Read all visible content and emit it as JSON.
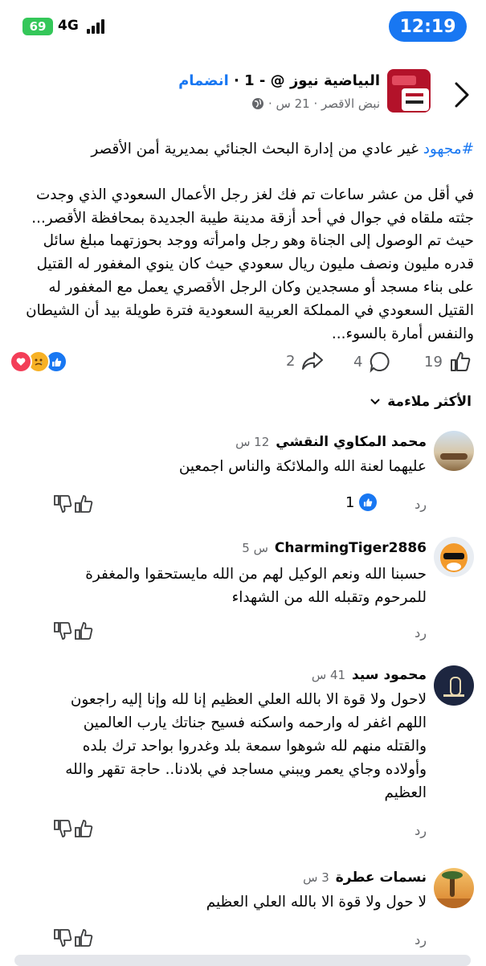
{
  "status_bar": {
    "time": "12:19",
    "battery": "69",
    "network": "4G"
  },
  "header": {
    "page_name": "البياضية نيوز @",
    "page_suffix": " - 1 · ",
    "join_label": "انضمام",
    "sub_text": "نبض الاقصر · 21 س ·"
  },
  "post": {
    "hashtag": "#مجهود",
    "headline": " غير عادي من إدارة البحث الجنائي بمديرية أمن الأقصر",
    "body": "في أقل من عشر ساعات تم فك لغز رجل الأعمال السعودي الذي وجدت جثته ملقاه في جوال في أحد أزقة مدينة طيبة الجديدة بمحافظة الأقصر... حيث تم الوصول إلى الجناة وهو رجل وامرأته ووجد بحوزتهما مبلغ سائل قدره مليون ونصف مليون ريال سعودي حيث كان ينوي المغفور له القتيل على بناء مسجد أو مسجدين وكان الرجل الأقصري يعمل مع المغفور له القتيل السعودي في المملكة العربية السعودية فترة طويلة بيد أن الشيطان والنفس أمارة بالسوء..."
  },
  "stats": {
    "likes": "19",
    "comments": "4",
    "shares": "2"
  },
  "sort_label": "الأكثر ملاءمة",
  "comments": [
    {
      "name": "محمد المكاوي النقشي",
      "time": "12 س",
      "text": "عليهما لعنة الله والملائكة والناس اجمعين",
      "likes": "1",
      "reply": "رد"
    },
    {
      "name": "CharmingTiger2886",
      "time": "5 س",
      "text": "حسبنا الله ونعم الوكيل لهم من الله مايستحقوا والمغفرة للمرحوم وتقبله الله من الشهداء",
      "reply": "رد"
    },
    {
      "name": "محمود سيد",
      "time": "41 س",
      "text": "لاحول ولا قوة الا بالله العلي العظيم إنا لله وإنا إليه راجعون اللهم اغفر له وارحمه واسكنه فسيح جناتك يارب العالمين والقتله منهم لله شوهوا سمعة بلد وغدروا بواحد ترك بلده وأولاده وجاي يعمر ويبني مساجد في بلادنا.. حاجة تقهر والله العظيم",
      "reply": "رد"
    },
    {
      "name": "نسمات عطرة",
      "time": "3 س",
      "text": "لا حول ولا قوة الا بالله العلي العظيم",
      "reply": "رد"
    }
  ]
}
